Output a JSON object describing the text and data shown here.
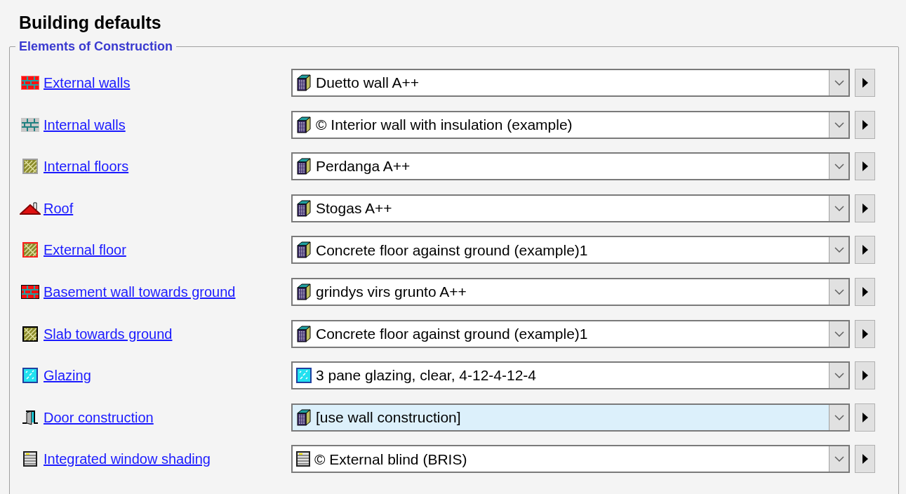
{
  "title": "Building defaults",
  "group": {
    "legend": "Elements of Construction",
    "rows": [
      {
        "label": "External walls",
        "value": "Duetto wall A++",
        "highlighted": false
      },
      {
        "label": "Internal walls",
        "value": "© Interior wall with insulation (example)",
        "highlighted": false
      },
      {
        "label": "Internal floors",
        "value": "Perdanga A++",
        "highlighted": false
      },
      {
        "label": "Roof",
        "value": "Stogas A++",
        "highlighted": false
      },
      {
        "label": "External floor",
        "value": "Concrete floor against ground (example)1",
        "highlighted": false
      },
      {
        "label": "Basement wall towards ground",
        "value": "grindys virs grunto A++",
        "highlighted": false
      },
      {
        "label": "Slab towards ground",
        "value": "Concrete floor against ground (example)1",
        "highlighted": false
      },
      {
        "label": "Glazing",
        "value": "3 pane glazing, clear, 4-12-4-12-4",
        "highlighted": false
      },
      {
        "label": "Door construction",
        "value": "[use wall construction]",
        "highlighted": true
      },
      {
        "label": "Integrated window shading",
        "value": "© External blind (BRIS)",
        "highlighted": false
      }
    ]
  }
}
